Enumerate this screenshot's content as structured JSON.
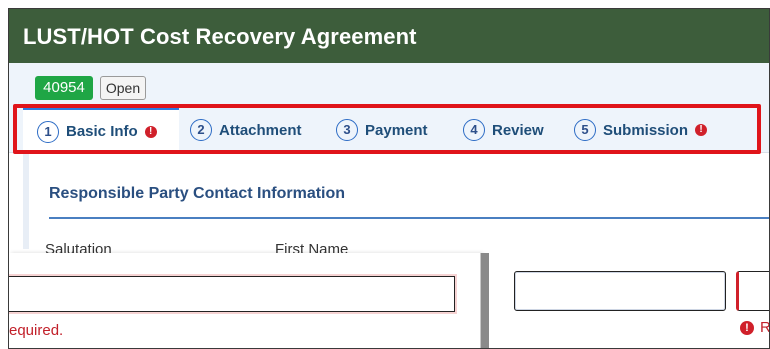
{
  "header": {
    "title": "LUST/HOT Cost Recovery Agreement"
  },
  "record": {
    "id": "40954",
    "status": "Open"
  },
  "tabs": [
    {
      "num": "1",
      "label": "Basic Info",
      "active": true,
      "error": true
    },
    {
      "num": "2",
      "label": "Attachment",
      "active": false,
      "error": false
    },
    {
      "num": "3",
      "label": "Payment",
      "active": false,
      "error": false
    },
    {
      "num": "4",
      "label": "Review",
      "active": false,
      "error": false
    },
    {
      "num": "5",
      "label": "Submission",
      "active": false,
      "error": true
    }
  ],
  "error_glyph": "!",
  "section": {
    "title": "Responsible Party Contact Information"
  },
  "fields": {
    "salutation_label": "Salutation",
    "first_name_label": "First Name"
  },
  "errors": {
    "left_partial": "equired.",
    "right_partial": "R"
  },
  "colors": {
    "header_bg": "#3d5d3b",
    "badge_green": "#1fa645",
    "highlight_red": "#e0141a",
    "accent_blue": "#2d7be0",
    "error_red": "#d0202a"
  }
}
